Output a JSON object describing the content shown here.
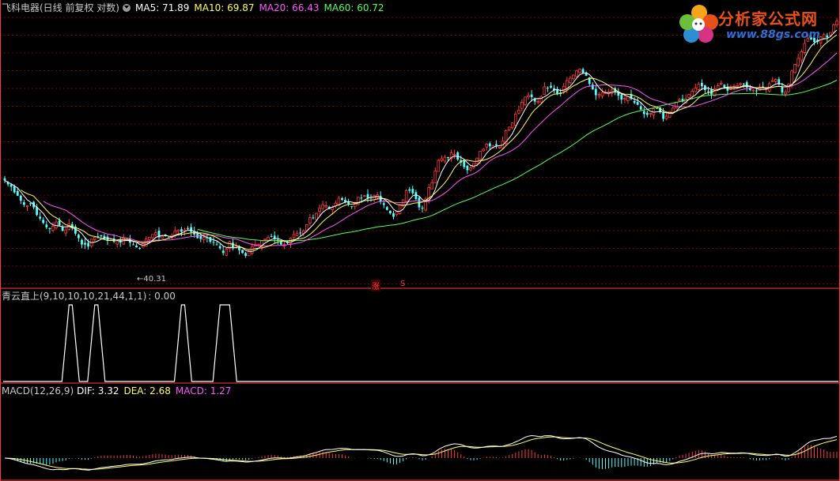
{
  "header": {
    "title": "飞科电器(日线 前复权 对数)",
    "ma5": "MA5: 71.89",
    "ma10": "MA10: 69.87",
    "ma20": "MA20: 66.43",
    "ma60": "MA60: 60.72"
  },
  "colors": {
    "up": "#ff3a3a",
    "down": "#54ffff",
    "ma5": "#ffffff",
    "ma10": "#ffff54",
    "ma20": "#ff54ff",
    "ma60": "#54ff54",
    "grid": "#7a0000",
    "divider": "#ff3a3a",
    "label": "#c8c8c8",
    "dif": "#ffffff",
    "dea": "#ffff54",
    "macd": "#ff54ff"
  },
  "low_marker": "40.31",
  "signal_tags": {
    "zhang": "涨",
    "s": "S"
  },
  "indicator": {
    "title": "青云直上(9,10,10,10,21,44,1,1)",
    "value": ": 0.00"
  },
  "macd_panel": {
    "title": "MACD(12,26,9)",
    "dif": "DIF: 3.32",
    "dea": "DEA: 2.68",
    "macd": "MACD: 1.27"
  },
  "logo": {
    "text": "分析家公式网",
    "url": "www.88gs.com"
  },
  "chart_data": {
    "type": "candlestick",
    "price_log_range": [
      40.31,
      75.5
    ],
    "low_value": 40.31,
    "close": [
      50.8,
      50.3,
      50.0,
      49.3,
      48.9,
      48.3,
      47.8,
      47.7,
      47.9,
      47.5,
      46.6,
      46.2,
      45.7,
      45.2,
      45.0,
      45.3,
      45.8,
      45.4,
      44.8,
      44.9,
      45.6,
      45.1,
      44.5,
      44.0,
      43.3,
      43.3,
      43.1,
      43.9,
      44.1,
      44.1,
      44.2,
      43.9,
      43.7,
      43.8,
      43.6,
      43.7,
      43.5,
      44.0,
      43.9,
      43.5,
      43.3,
      43.0,
      42.9,
      43.4,
      43.9,
      44.1,
      44.4,
      44.6,
      44.1,
      44.2,
      44.2,
      44.0,
      44.3,
      44.8,
      44.9,
      44.7,
      44.9,
      45.1,
      44.7,
      44.4,
      44.0,
      43.9,
      44.1,
      44.0,
      43.6,
      43.5,
      43.3,
      42.9,
      42.4,
      42.8,
      43.6,
      43.0,
      43.1,
      42.7,
      42.4,
      42.1,
      42.6,
      43.1,
      43.3,
      43.3,
      43.7,
      43.9,
      44.1,
      44.2,
      43.9,
      43.7,
      43.3,
      43.3,
      43.5,
      44.0,
      44.4,
      44.5,
      44.6,
      44.8,
      45.5,
      46.3,
      46.3,
      46.8,
      47.4,
      47.8,
      47.7,
      47.3,
      47.5,
      48.0,
      48.6,
      48.4,
      48.1,
      47.9,
      47.6,
      48.1,
      48.7,
      48.6,
      48.9,
      48.6,
      48.7,
      48.9,
      49.0,
      48.2,
      47.8,
      47.2,
      46.8,
      46.4,
      47.0,
      47.8,
      48.4,
      49.5,
      49.5,
      49.2,
      48.5,
      47.5,
      47.4,
      48.5,
      49.9,
      50.5,
      52.0,
      53.4,
      53.6,
      53.8,
      53.7,
      54.4,
      54.2,
      53.5,
      53.1,
      52.5,
      52.1,
      52.4,
      53.0,
      53.7,
      54.6,
      54.9,
      55.6,
      55.3,
      55.4,
      55.4,
      55.2,
      56.0,
      57.5,
      58.0,
      58.6,
      59.9,
      60.5,
      61.7,
      62.5,
      62.7,
      62.5,
      61.8,
      61.8,
      62.6,
      64.1,
      63.9,
      64.0,
      63.5,
      63.0,
      63.2,
      64.2,
      65.1,
      65.5,
      66.0,
      66.7,
      67.0,
      66.3,
      65.9,
      64.6,
      63.7,
      62.8,
      62.9,
      63.2,
      63.3,
      63.3,
      63.6,
      63.3,
      62.7,
      62.1,
      62.3,
      62.6,
      62.2,
      61.6,
      61.3,
      60.6,
      59.9,
      59.8,
      60.0,
      60.7,
      60.8,
      60.2,
      59.2,
      59.6,
      60.3,
      60.8,
      61.7,
      62.1,
      61.8,
      62.2,
      62.9,
      63.4,
      63.9,
      64.5,
      64.2,
      63.6,
      63.3,
      62.9,
      63.8,
      64.3,
      64.7,
      64.0,
      63.5,
      63.9,
      64.2,
      64.3,
      64.6,
      64.5,
      64.0,
      63.6,
      63.6,
      63.4,
      63.9,
      64.0,
      63.8,
      64.6,
      65.1,
      65.3,
      64.5,
      63.2,
      63.3,
      64.5,
      66.7,
      67.8,
      68.8,
      70.0,
      71.4,
      72.3,
      72.1,
      71.7,
      71.7,
      72.6,
      73.0,
      72.5,
      73.4,
      74.8,
      75.5
    ],
    "ma60_start_index": 60,
    "indicator_spikes": [
      {
        "name": "spike-1",
        "peak_start": 20,
        "peak_end": 21
      },
      {
        "name": "spike-2",
        "peak_start": 28,
        "peak_end": 29
      },
      {
        "name": "spike-3",
        "peak_start": 55,
        "peak_end": 56
      },
      {
        "name": "spike-4",
        "peak_start": 67,
        "peak_end": 70
      }
    ]
  }
}
